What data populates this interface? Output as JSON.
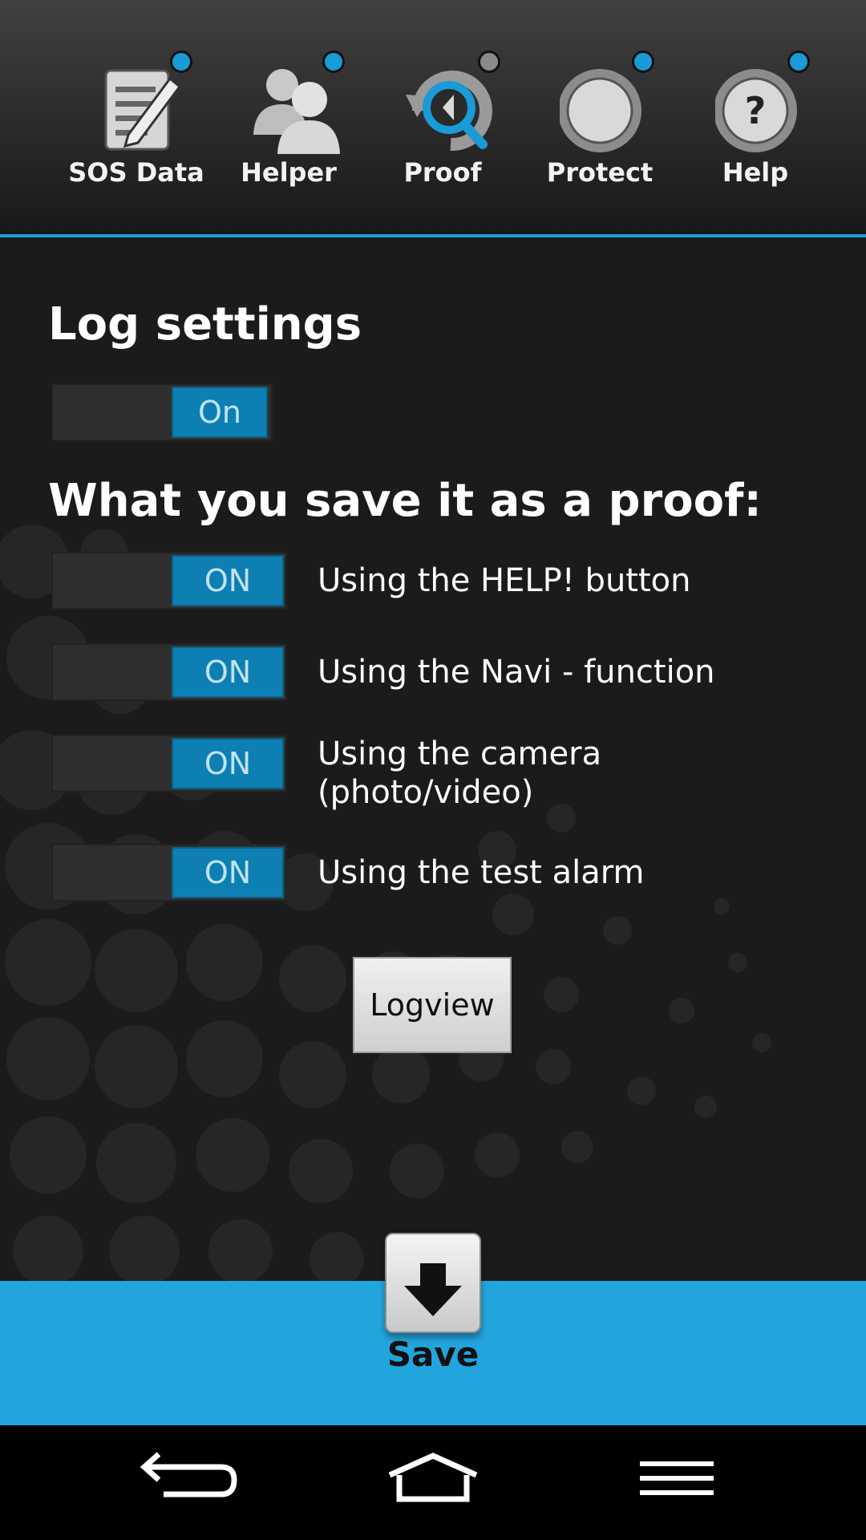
{
  "tabs": [
    {
      "label": "SOS Data",
      "icon": "notepad-pencil-icon",
      "indicator": "#1a9ad6"
    },
    {
      "label": "Helper",
      "icon": "people-icon",
      "indicator": "#1a9ad6"
    },
    {
      "label": "Proof",
      "icon": "proof-search-icon",
      "indicator": "#8a8a8a"
    },
    {
      "label": "Protect",
      "icon": "protect-circle-icon",
      "indicator": "#1a9ad6"
    },
    {
      "label": "Help",
      "icon": "help-question-icon",
      "indicator": "#1a9ad6"
    }
  ],
  "log_settings": {
    "title": "Log settings",
    "toggle": "On"
  },
  "proof": {
    "title": "What you save it as a proof:",
    "options": [
      {
        "toggle": "ON",
        "label": "Using the HELP! button"
      },
      {
        "toggle": "ON",
        "label": "Using the Navi - function"
      },
      {
        "toggle": "ON",
        "label": "Using the camera (photo/video)"
      },
      {
        "toggle": "ON",
        "label": "Using the test alarm"
      }
    ]
  },
  "logview_label": "Logview",
  "save_label": "Save",
  "colors": {
    "accent": "#22a5dd",
    "toggle_on": "#0d7fb3"
  }
}
